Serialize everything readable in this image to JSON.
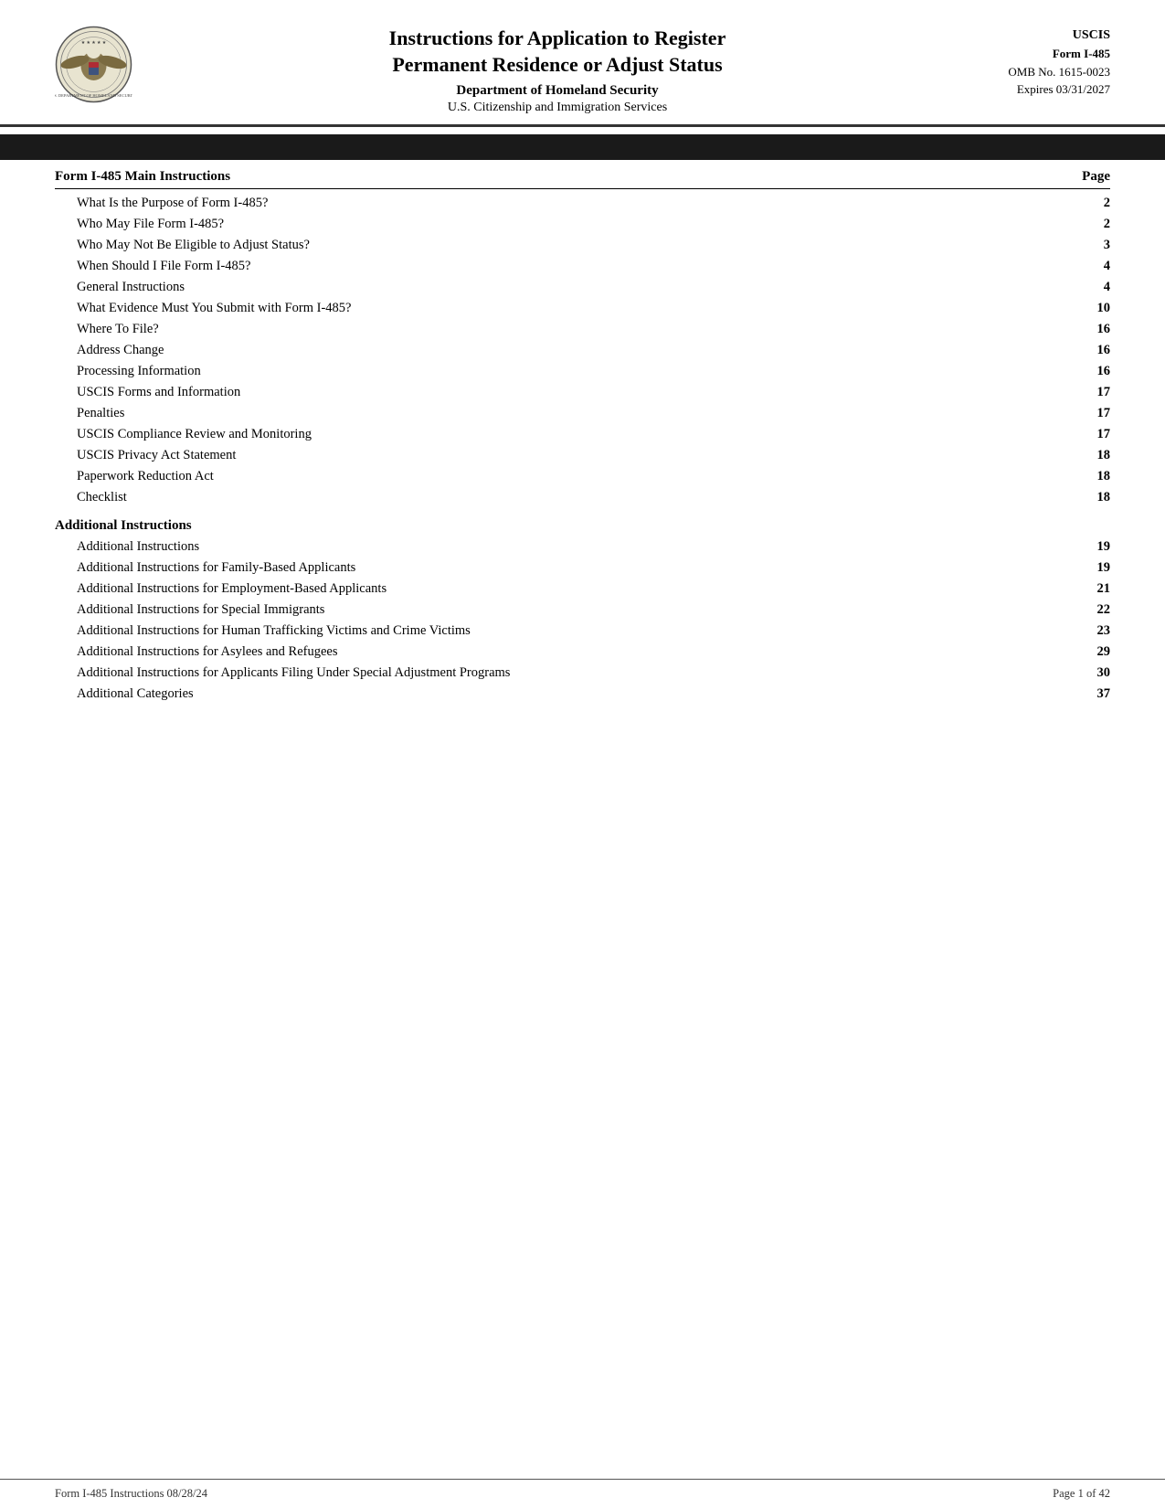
{
  "header": {
    "title_line1": "Instructions for Application to Register",
    "title_line2": "Permanent Residence or Adjust Status",
    "department": "Department of Homeland Security",
    "agency": "U.S. Citizenship and Immigration Services",
    "uscis_label": "USCIS",
    "form_number": "Form I-485",
    "omb": "OMB No. 1615-0023",
    "expires": "Expires 03/31/2027"
  },
  "toc": {
    "col_header_left": "Form I-485 Main Instructions",
    "col_header_right": "Page",
    "rows": [
      {
        "label": "What Is the Purpose of Form I-485?",
        "page": "2",
        "indent": true,
        "bold": false
      },
      {
        "label": "Who May File Form I-485?",
        "page": "2",
        "indent": true,
        "bold": false
      },
      {
        "label": "Who May Not Be Eligible to Adjust Status?",
        "page": "3",
        "indent": true,
        "bold": false
      },
      {
        "label": "When Should I File Form I-485?",
        "page": "4",
        "indent": true,
        "bold": false
      },
      {
        "label": "General Instructions",
        "page": "4",
        "indent": true,
        "bold": false
      },
      {
        "label": "What Evidence Must You Submit with Form I-485?",
        "page": "10",
        "indent": true,
        "bold": false
      },
      {
        "label": "Where To File?",
        "page": "16",
        "indent": true,
        "bold": false
      },
      {
        "label": "Address Change",
        "page": "16",
        "indent": true,
        "bold": false
      },
      {
        "label": "Processing Information",
        "page": "16",
        "indent": true,
        "bold": false
      },
      {
        "label": "USCIS Forms and Information",
        "page": "17",
        "indent": true,
        "bold": false
      },
      {
        "label": "Penalties",
        "page": "17",
        "indent": true,
        "bold": false
      },
      {
        "label": "USCIS Compliance Review and Monitoring",
        "page": "17",
        "indent": true,
        "bold": false
      },
      {
        "label": "USCIS Privacy Act Statement",
        "page": "18",
        "indent": true,
        "bold": false
      },
      {
        "label": "Paperwork Reduction Act",
        "page": "18",
        "indent": true,
        "bold": false
      },
      {
        "label": "Checklist",
        "page": "18",
        "indent": true,
        "bold": false
      }
    ],
    "section2_header": "Additional Instructions",
    "section2_rows": [
      {
        "label": "Additional Instructions",
        "page": "19",
        "indent": true
      },
      {
        "label": "Additional Instructions for Family-Based Applicants",
        "page": "19",
        "indent": true
      },
      {
        "label": "Additional Instructions for Employment-Based Applicants",
        "page": "21",
        "indent": true
      },
      {
        "label": "Additional Instructions for Special Immigrants",
        "page": "22",
        "indent": true
      },
      {
        "label": "Additional Instructions for Human Trafficking Victims and Crime Victims",
        "page": "23",
        "indent": true
      },
      {
        "label": "Additional Instructions for Asylees and Refugees",
        "page": "29",
        "indent": true
      },
      {
        "label": "Additional Instructions for Applicants Filing Under Special Adjustment Programs",
        "page": "30",
        "indent": true
      },
      {
        "label": "Additional Categories",
        "page": "37",
        "indent": true
      }
    ]
  },
  "footer": {
    "left": "Form I-485 Instructions   08/28/24",
    "right": "Page 1 of 42"
  }
}
